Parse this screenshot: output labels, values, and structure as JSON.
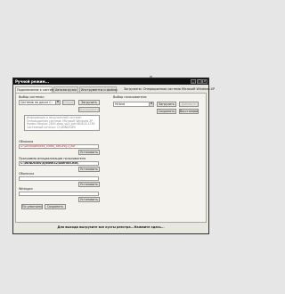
{
  "window": {
    "title": "Ручной режим..."
  },
  "header": {
    "loaded_label": "Загружено: Операционная система Microsoft Windows XP"
  },
  "tabs": [
    {
      "label": "Подключение к системе"
    },
    {
      "label": "Автозагрузка"
    },
    {
      "label": "Инструменты и файлы"
    }
  ],
  "system_select": {
    "label": "Выбор системы:",
    "value": "Система на диске C:",
    "load_button": "Загрузить",
    "open_button": "Открыть",
    "tools_button": "Инструменты",
    "info_lines": [
      "Информация о загруженной системе:",
      "Операционная система: Microsoft Windows XP",
      "Номер сборки: 2600.xpsp_sp3_gdr.080814-1236",
      "Системный каталог: D:\\WINDOWS"
    ]
  },
  "user_select": {
    "label": "Выбор пользователя:",
    "value": "Hirbird",
    "load_button": "Загрузить",
    "add_button": "Добавить",
    "save_button": "Сохранить",
    "restore_button": "Восстановить"
  },
  "fields": {
    "wallpaper_label": "Обложка",
    "wallpaper_value": "D:\\Dir\\Видео\\xxx_video_386.avi[1].avi",
    "wallpaper_button": "Установить",
    "init_label": "Программа инициализации пользователя",
    "init_value": "C:\\WINDOWS\\system32\\userinit.exe,",
    "init_button": "Установить",
    "shell_label": "Оболочка",
    "shell_value": "",
    "shell_button": "Установить",
    "winlogon_label": "Winlogon",
    "winlogon_value": "",
    "winlogon_button": "Установить",
    "default_button": "По умолчанию",
    "save_button": "Сохранить"
  },
  "footer": {
    "text": "Для выхода выгрузите все кусты реестра...Нажмите здесь..."
  },
  "colors": {
    "titlebar": "#101010",
    "highlight_red": "#d22222"
  }
}
